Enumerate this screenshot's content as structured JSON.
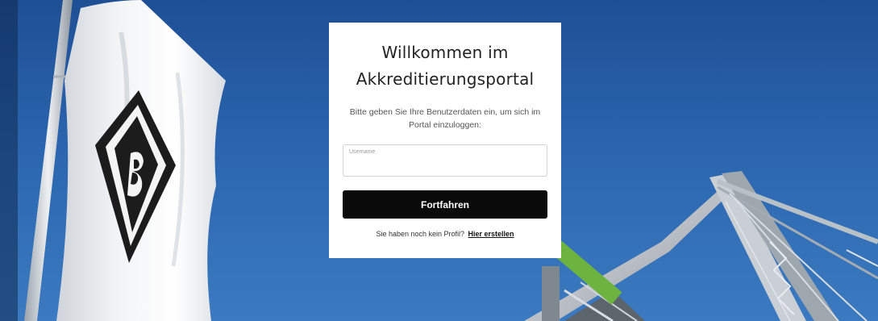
{
  "login": {
    "title_line1": "Willkommen im",
    "title_line2": "Akkreditierungsportal",
    "subtitle": "Bitte geben Sie Ihre Benutzerdaten ein, um sich im Portal einzuloggen:",
    "username_label": "Username",
    "username_value": "",
    "submit_label": "Fortfahren",
    "register_prompt": "Sie haben noch kein Profil?",
    "register_link": "Hier erstellen"
  },
  "annotation": {
    "arrow_color": "#6cb33f",
    "arrow_icon": "arrow-up-left-icon"
  },
  "colors": {
    "sky": "#2a65ae",
    "button": "#0a0a0a",
    "card": "#ffffff"
  }
}
